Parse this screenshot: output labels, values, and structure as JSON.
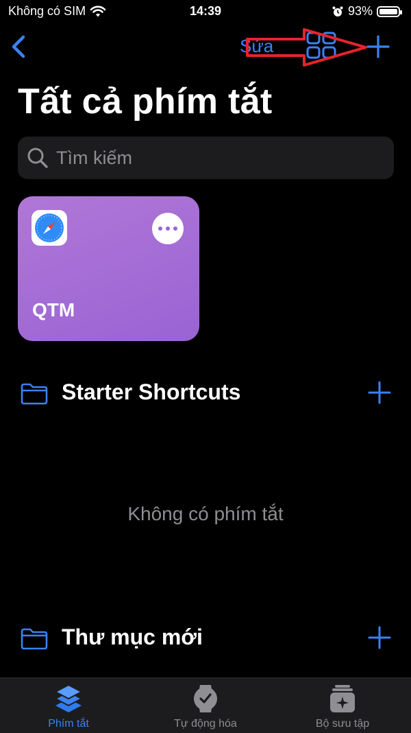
{
  "status": {
    "carrier": "Không có SIM",
    "time": "14:39",
    "battery": "93%",
    "battery_level": 0.93
  },
  "nav": {
    "edit_label": "Sửa"
  },
  "title": "Tất cả phím tắt",
  "search": {
    "placeholder": "Tìm kiếm"
  },
  "shortcuts": [
    {
      "label": "QTM",
      "icon": "safari-icon",
      "color": "#9a63d3"
    }
  ],
  "folders": [
    {
      "title": "Starter Shortcuts",
      "empty_text": "Không có phím tắt"
    },
    {
      "title": "Thư mục mới"
    }
  ],
  "tabs": [
    {
      "label": "Phím tắt",
      "icon": "layers-icon",
      "active": true
    },
    {
      "label": "Tự động hóa",
      "icon": "clock-icon",
      "active": false
    },
    {
      "label": "Bộ sưu tập",
      "icon": "gallery-icon",
      "active": false
    }
  ],
  "colors": {
    "accent": "#3b82f6",
    "annotation": "#e8232b",
    "card": "#9a63d3"
  }
}
